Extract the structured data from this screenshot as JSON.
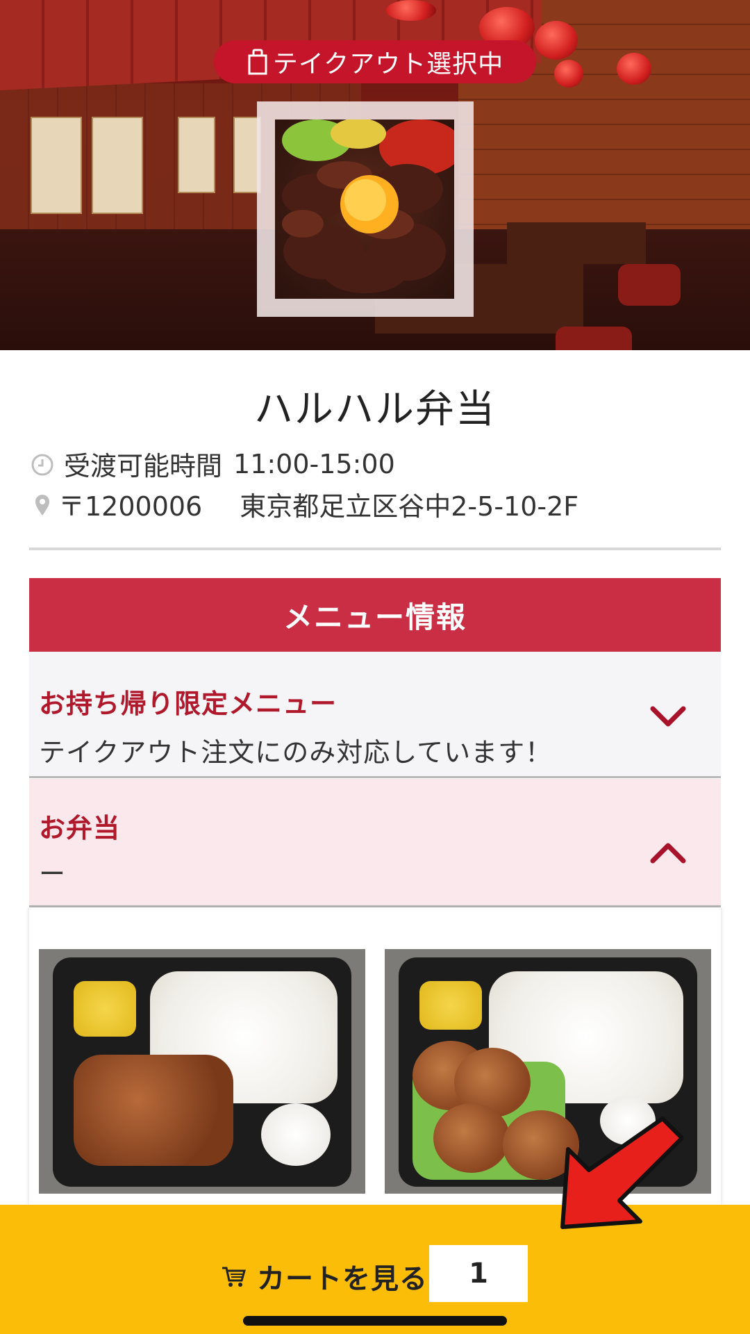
{
  "banner": {
    "takeout_label": "テイクアウト選択中"
  },
  "store": {
    "name": "ハルハル弁当",
    "hours_label": "受渡可能時間",
    "hours_value": "11:00-15:00",
    "postal": "〒1200006",
    "address": "東京都足立区谷中2-5-10-2F"
  },
  "menu": {
    "header": "メニュー情報",
    "categories": [
      {
        "title": "お持ち帰り限定メニュー",
        "desc": "テイクアウト注文にのみ対応しています！",
        "state": "collapsed"
      },
      {
        "title": "お弁当",
        "desc": "ー",
        "state": "expanded"
      }
    ]
  },
  "cart": {
    "label": "カートを見る",
    "count": "1"
  },
  "icons": {
    "takeout": "shopping-bag-icon",
    "hours": "clock-icon",
    "address": "location-pin-icon",
    "cart": "cart-icon",
    "expand": "chevron-down-icon",
    "collapse": "chevron-up-icon"
  },
  "colors": {
    "accent_red": "#c92e44",
    "category_title": "#b0182c",
    "cart_bar": "#fbbd08",
    "takeout_pill": "#c4152a"
  }
}
